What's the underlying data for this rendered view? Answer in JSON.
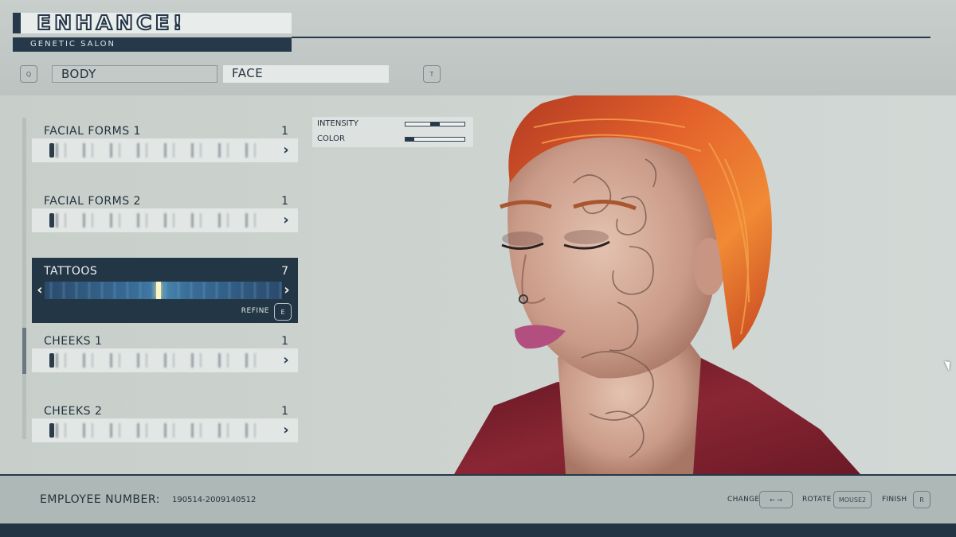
{
  "header": {
    "logo": "ENHANCE!",
    "subtitle": "GENETIC SALON",
    "tabs": [
      {
        "label": "BODY",
        "active": false
      },
      {
        "label": "FACE",
        "active": true
      }
    ],
    "prev_tab_key": "Q",
    "next_tab_key": "T"
  },
  "categories": [
    {
      "label": "FACIAL FORMS 1",
      "value": "1"
    },
    {
      "label": "FACIAL FORMS 2",
      "value": "1"
    },
    {
      "label": "TATTOOS",
      "value": "7",
      "selected": true,
      "refine_label": "REFINE",
      "refine_key": "E"
    },
    {
      "label": "CHEEKS 1",
      "value": "1"
    },
    {
      "label": "CHEEKS 2",
      "value": "1"
    }
  ],
  "adjustments": {
    "intensity": {
      "label": "INTENSITY",
      "level": 0.5
    },
    "color": {
      "label": "COLOR",
      "level": 0.15
    }
  },
  "footer": {
    "employee_label": "EMPLOYEE NUMBER:",
    "employee_number": "190514-2009140512",
    "hints": [
      {
        "label": "CHANGE",
        "key": "← →"
      },
      {
        "label": "ROTATE",
        "key": "MOUSE2"
      },
      {
        "label": "FINISH",
        "key": "R"
      }
    ]
  },
  "colors": {
    "accent": "#233645",
    "hair": "#e0582a",
    "lips": "#b34f7f",
    "jacket": "#7a1f2c",
    "skin": "#d9b4a0",
    "selection_strip": "#3a6e99"
  }
}
